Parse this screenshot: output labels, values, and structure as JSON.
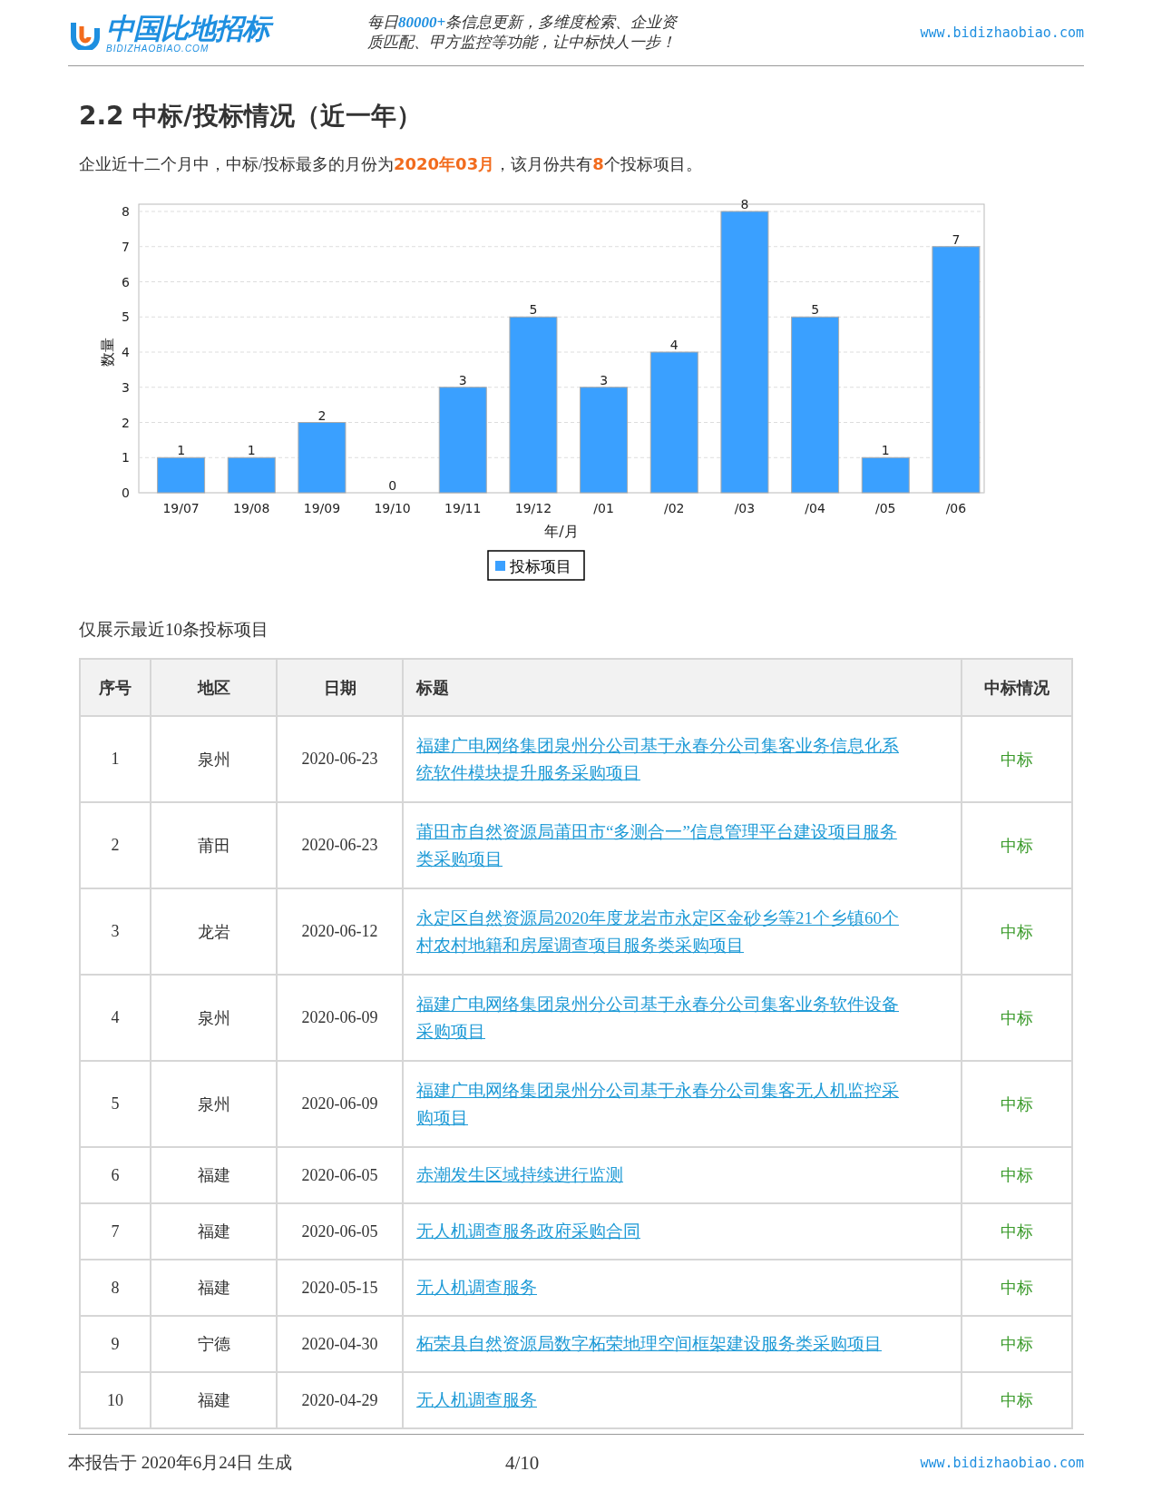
{
  "header": {
    "logo": {
      "name": "中国比地招标",
      "subtitle": "BIDIZHAOBIAO.COM"
    },
    "tagline": "每日**80000+**条信息更新，多维度检索、企业资质匹配、甲方监控等功能，让中标快人一步！",
    "url": "www.bidizhaobiao.com"
  },
  "section": {
    "title": "2.2 中标/投标情况（近一年）",
    "summary": "企业近十二个月中，中标/投标最多的月份为**2020年03月**，该月份共有**8**个投标项目。",
    "chart_data": {
      "type": "bar",
      "xlabel": "年/月",
      "ylabel": "数量",
      "categories": [
        "19/07",
        "19/08",
        "19/09",
        "19/10",
        "19/11",
        "19/12",
        "/01",
        "/02",
        "/03",
        "/04",
        "/05",
        "/06"
      ],
      "series": [
        {
          "name": "投标项目",
          "color": "#3aa0ff",
          "values": [
            1,
            1,
            2,
            0,
            3,
            5,
            3,
            4,
            8,
            5,
            1,
            7
          ]
        }
      ],
      "ylim": [
        0,
        8
      ],
      "grid": true,
      "yticks": [
        0,
        1,
        2,
        3,
        4,
        5,
        6,
        7,
        8
      ],
      "data_labels": true
    },
    "table_note": "仅展示最近10条投标项目",
    "table": {
      "columns": [
        "序号",
        "地区",
        "日期",
        "标题",
        "中标情况"
      ],
      "rows": [
        {
          "no": "1",
          "region": "泉州",
          "date": "2020-06-23",
          "title": "福建广电网络集团泉州分公司基于永春分公司集客业务信息化系统软件模块提升服务采购项目",
          "status": "中标"
        },
        {
          "no": "2",
          "region": "莆田",
          "date": "2020-06-23",
          "title": "莆田市自然资源局莆田市“多测合一”信息管理平台建设项目服务类采购项目",
          "status": "中标"
        },
        {
          "no": "3",
          "region": "龙岩",
          "date": "2020-06-12",
          "title": "永定区自然资源局2020年度龙岩市永定区金砂乡等21个乡镇60个村农村地籍和房屋调查项目服务类采购项目",
          "status": "中标"
        },
        {
          "no": "4",
          "region": "泉州",
          "date": "2020-06-09",
          "title": "福建广电网络集团泉州分公司基于永春分公司集客业务软件设备采购项目",
          "status": "中标"
        },
        {
          "no": "5",
          "region": "泉州",
          "date": "2020-06-09",
          "title": "福建广电网络集团泉州分公司基于永春分公司集客无人机监控采购项目",
          "status": "中标"
        },
        {
          "no": "6",
          "region": "福建",
          "date": "2020-06-05",
          "title": "赤潮发生区域持续进行监测",
          "status": "中标"
        },
        {
          "no": "7",
          "region": "福建",
          "date": "2020-06-05",
          "title": "无人机调查服务政府采购合同",
          "status": "中标"
        },
        {
          "no": "8",
          "region": "福建",
          "date": "2020-05-15",
          "title": "无人机调查服务",
          "status": "中标"
        },
        {
          "no": "9",
          "region": "宁德",
          "date": "2020-04-30",
          "title": "柘荣县自然资源局数字柘荣地理空间框架建设服务类采购项目",
          "status": "中标"
        },
        {
          "no": "10",
          "region": "福建",
          "date": "2020-04-29",
          "title": "无人机调查服务",
          "status": "中标"
        }
      ]
    }
  },
  "footer": {
    "generated": "本报告于 2020年6月24日 生成",
    "page": "4/10",
    "url": "www.bidizhaobiao.com"
  }
}
